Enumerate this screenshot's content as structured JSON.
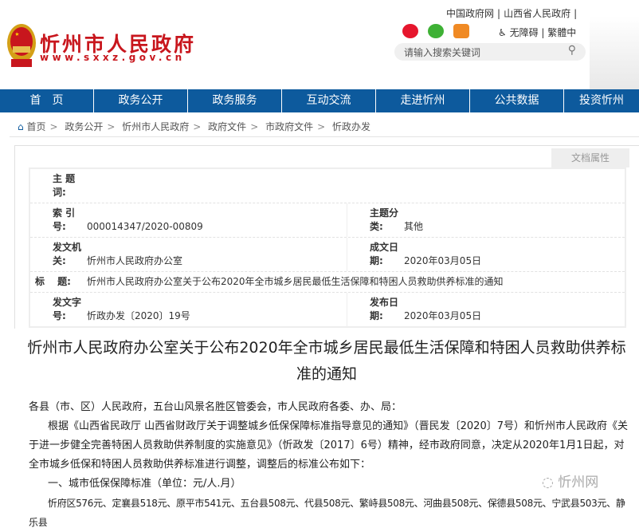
{
  "header": {
    "site_name": "忻州市人民政府",
    "site_url": "www.sxxz.gov.cn",
    "top_links": [
      "中国政府网",
      "|",
      "山西省人民政府",
      "|"
    ],
    "accessibility": "无障碍",
    "traditional": "繁體中",
    "search_placeholder": "请输入搜索关键词"
  },
  "nav": [
    "首　页",
    "政务公开",
    "政务服务",
    "互动交流",
    "走进忻州",
    "公共数据",
    "投资忻州"
  ],
  "breadcrumb": [
    "首页",
    "政务公开",
    "忻州市人民政府",
    "政府文件",
    "市政府文件",
    "忻政办发"
  ],
  "breadcrumb_sep": ">",
  "doc_tab": "文档属性",
  "meta": {
    "subject_words_label": "主 题 词:",
    "subject_words": "",
    "index_label": "索 引 号:",
    "index": "000014347/2020-00809",
    "category_label": "主题分 类:",
    "category": "其他",
    "issuer_label": "发文机 关:",
    "issuer": "忻州市人民政府办公室",
    "date_label": "成文日 期:",
    "date": "2020年03月05日",
    "title_label": "标　 题:",
    "title": "忻州市人民政府办公室关于公布2020年全市城乡居民最低生活保障和特困人员救助供养标准的通知",
    "docno_label": "发文字 号:",
    "docno": "忻政办发〔2020〕19号",
    "pubdate_label": "发布日 期:",
    "pubdate": "2020年03月05日"
  },
  "article": {
    "title": "忻州市人民政府办公室关于公布2020年全市城乡居民最低生活保障和特困人员救助供养标准的通知",
    "paragraphs": [
      "各县（市、区）人民政府，五台山风景名胜区管委会，市人民政府各委、办、局：",
      "根据《山西省民政厅 山西省财政厅关于调整城乡低保保障标准指导意见的通知》（晋民发〔2020〕7号）和忻州市人民政府《关于进一步健全完善特困人员救助供养制度的实施意见》（忻政发〔2017〕6号）精神，经市政府同意，决定从2020年1月1日起，对全市城乡低保和特困人员救助供养标准进行调整，调整后的标准公布如下：",
      "一、城市低保保障标准（单位：元/人.月）",
      "忻府区576元、定襄县518元、原平市541元、五台县508元、代县508元、繁峙县508元、河曲县508元、保德县508元、宁武县503元、静乐县"
    ]
  },
  "watermark": "忻州网"
}
